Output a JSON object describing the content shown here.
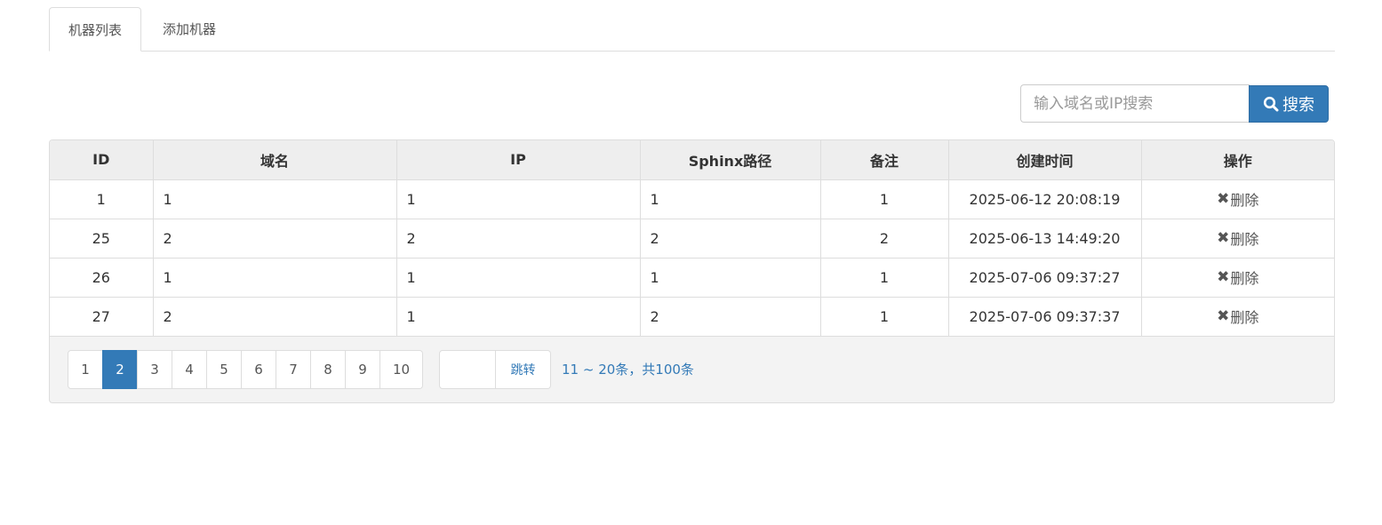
{
  "tabs": [
    {
      "label": "机器列表",
      "active": true
    },
    {
      "label": "添加机器",
      "active": false
    }
  ],
  "search": {
    "placeholder": "输入域名或IP搜索",
    "value": "",
    "button_label": "搜索",
    "button_icon": "search-icon"
  },
  "table": {
    "columns": [
      "ID",
      "域名",
      "IP",
      "Sphinx路径",
      "备注",
      "创建时间",
      "操作"
    ],
    "rows": [
      {
        "id": "1",
        "domain": "1",
        "ip": "1",
        "sphinx_path": "1",
        "remark": "1",
        "created_at": "2025-06-12 20:08:19",
        "action": "删除"
      },
      {
        "id": "25",
        "domain": "2",
        "ip": "2",
        "sphinx_path": "2",
        "remark": "2",
        "created_at": "2025-06-13 14:49:20",
        "action": "删除"
      },
      {
        "id": "26",
        "domain": "1",
        "ip": "1",
        "sphinx_path": "1",
        "remark": "1",
        "created_at": "2025-07-06 09:37:27",
        "action": "删除"
      },
      {
        "id": "27",
        "domain": "2",
        "ip": "1",
        "sphinx_path": "2",
        "remark": "1",
        "created_at": "2025-07-06 09:37:37",
        "action": "删除"
      }
    ],
    "delete_icon": "close-icon",
    "delete_glyph": "✖"
  },
  "pagination": {
    "pages": [
      "1",
      "2",
      "3",
      "4",
      "5",
      "6",
      "7",
      "8",
      "9",
      "10"
    ],
    "current_page": "2",
    "jump_value": "",
    "jump_label": "跳转",
    "range_text": "11 ~ 20条，共100条"
  },
  "colors": {
    "accent": "#337ab7",
    "border": "#dddddd",
    "header_bg": "#eeeeee",
    "footer_bg": "#f3f3f3"
  }
}
